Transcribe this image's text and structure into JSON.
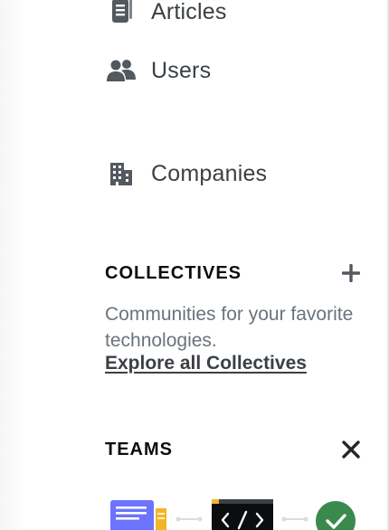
{
  "nav": {
    "items": [
      {
        "label": "Articles",
        "icon": "article-icon"
      },
      {
        "label": "Users",
        "icon": "users-icon"
      },
      {
        "label": "Companies",
        "icon": "building-icon"
      }
    ]
  },
  "collectives": {
    "title": "COLLECTIVES",
    "add_icon": "plus-icon",
    "description": "Communities for your favorite technologies.",
    "link_label": "Explore all Collectives"
  },
  "teams": {
    "title": "TEAMS",
    "close_icon": "close-icon"
  },
  "colors": {
    "icon": "#525960",
    "text": "#3b4045",
    "muted": "#6a737c",
    "heading": "#0c0d0e",
    "teams_blue": "#6b73ff",
    "teams_yellow": "#f2b526",
    "teams_dark": "#0c0d0e",
    "teams_green": "#3a8a4d"
  }
}
